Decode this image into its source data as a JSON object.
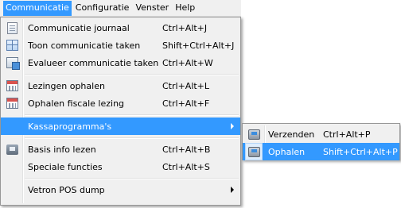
{
  "menubar": {
    "items": [
      {
        "label": "Communicatie"
      },
      {
        "label": "Configuratie"
      },
      {
        "label": "Venster"
      },
      {
        "label": "Help"
      }
    ]
  },
  "menu": {
    "items": [
      {
        "label": "Communicatie journaal",
        "shortcut": "Ctrl+Alt+J",
        "icon": "journal-icon"
      },
      {
        "label": "Toon communicatie taken",
        "shortcut": "Shift+Ctrl+Alt+J",
        "icon": "tasks-grid-icon"
      },
      {
        "label": "Evalueer communicatie taken",
        "shortcut": "Ctrl+Alt+W",
        "icon": "evaluate-icon"
      },
      {
        "label": "Lezingen ophalen",
        "shortcut": "Ctrl+Alt+L",
        "icon": "calendar-icon"
      },
      {
        "label": "Ophalen fiscale lezing",
        "shortcut": "Ctrl+Alt+F",
        "icon": "calendar-icon"
      },
      {
        "label": "Kassaprogramma's",
        "shortcut": "",
        "icon": ""
      },
      {
        "label": "Basis info lezen",
        "shortcut": "Ctrl+Alt+B",
        "icon": "info-icon"
      },
      {
        "label": "Speciale functies",
        "shortcut": "Ctrl+Alt+S",
        "icon": ""
      },
      {
        "label": "Vetron POS dump",
        "shortcut": "",
        "icon": ""
      }
    ]
  },
  "submenu": {
    "items": [
      {
        "label": "Verzenden",
        "shortcut": "Ctrl+Alt+P",
        "icon": "cash-register-icon"
      },
      {
        "label": "Ophalen",
        "shortcut": "Shift+Ctrl+Alt+P",
        "icon": "cash-register-icon"
      }
    ]
  },
  "colors": {
    "highlight": "#3399ff",
    "menu_bg": "#f0f0f0"
  }
}
